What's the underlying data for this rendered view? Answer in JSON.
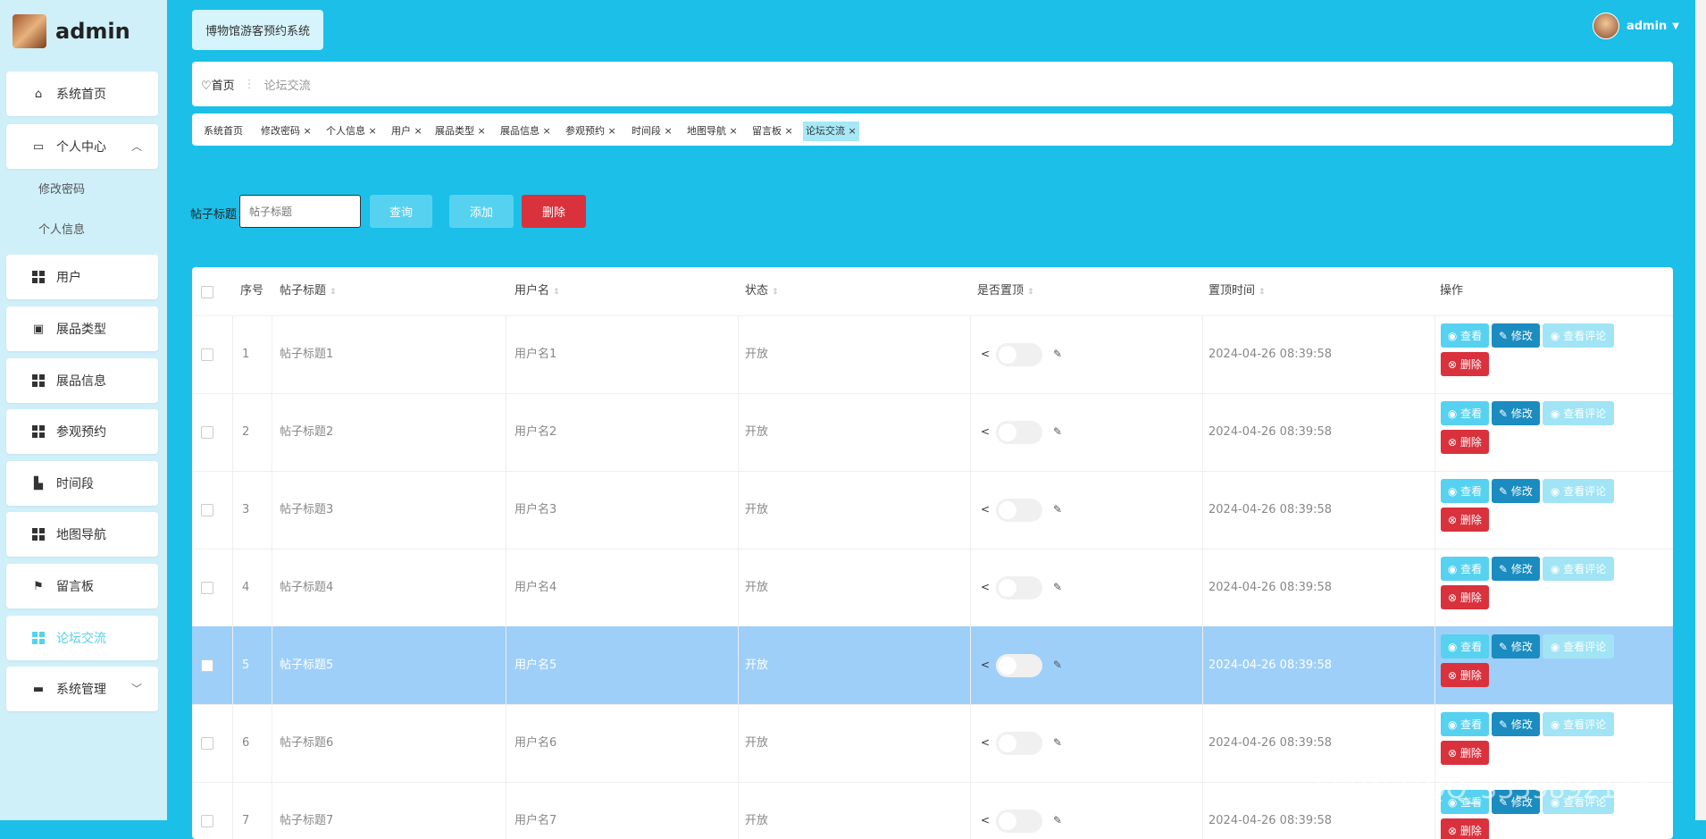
{
  "app": {
    "title": "admin",
    "system_name": "博物馆游客预约系统",
    "user": "admin"
  },
  "sidebar": {
    "items": [
      {
        "label": "系统首页",
        "icon": "home-icon"
      },
      {
        "label": "个人中心",
        "icon": "calendar-icon",
        "expanded": true,
        "children": [
          "修改密码",
          "个人信息"
        ]
      },
      {
        "label": "用户",
        "icon": "grid-icon"
      },
      {
        "label": "展品类型",
        "icon": "clipboard-icon"
      },
      {
        "label": "展品信息",
        "icon": "grid-icon"
      },
      {
        "label": "参观预约",
        "icon": "grid-icon"
      },
      {
        "label": "时间段",
        "icon": "mailbox-icon"
      },
      {
        "label": "地图导航",
        "icon": "grid-icon"
      },
      {
        "label": "留言板",
        "icon": "flag-icon"
      },
      {
        "label": "论坛交流",
        "icon": "grid-icon",
        "active": true
      },
      {
        "label": "系统管理",
        "icon": "briefcase-icon"
      }
    ]
  },
  "breadcrumb": {
    "home": "首页",
    "current": "论坛交流"
  },
  "tabs": [
    "系统首页",
    "修改密码",
    "个人信息",
    "用户",
    "展品类型",
    "展品信息",
    "参观预约",
    "时间段",
    "地图导航",
    "留言板",
    "论坛交流"
  ],
  "active_tab": "论坛交流",
  "search": {
    "label": "帖子标题",
    "placeholder": "帖子标题",
    "query_button": "查询",
    "add_button": "添加",
    "delete_button": "删除"
  },
  "table": {
    "columns": [
      "序号",
      "帖子标题",
      "用户名",
      "状态",
      "是否置顶",
      "置顶时间",
      "操作"
    ],
    "actions": {
      "view": "查看",
      "edit": "修改",
      "comments": "查看评论",
      "delete": "删除"
    },
    "rows": [
      {
        "id": "1",
        "title": "帖子标题1",
        "user": "用户名1",
        "status": "开放",
        "time": "2024-04-26 08:39:58"
      },
      {
        "id": "2",
        "title": "帖子标题2",
        "user": "用户名2",
        "status": "开放",
        "time": "2024-04-26 08:39:58"
      },
      {
        "id": "3",
        "title": "帖子标题3",
        "user": "用户名3",
        "status": "开放",
        "time": "2024-04-26 08:39:58"
      },
      {
        "id": "4",
        "title": "帖子标题4",
        "user": "用户名4",
        "status": "开放",
        "time": "2024-04-26 08:39:58"
      },
      {
        "id": "5",
        "title": "帖子标题5",
        "user": "用户名5",
        "status": "开放",
        "time": "2024-04-26 08:39:58",
        "highlight": true
      },
      {
        "id": "6",
        "title": "帖子标题6",
        "user": "用户名6",
        "status": "开放",
        "time": "2024-04-26 08:39:58"
      },
      {
        "id": "7",
        "title": "帖子标题7",
        "user": "用户名7",
        "status": "开放",
        "time": "2024-04-26 08:39:58"
      }
    ]
  },
  "watermark": "CSDN @QQ_3359892174",
  "colors": {
    "header_bg": "#1bbfe8",
    "sidebar_bg": "#cfeff9",
    "accent": "#56d2f0",
    "danger": "#d9323d",
    "edit": "#1a8cc0",
    "row_highlight": "#9ecff9"
  }
}
